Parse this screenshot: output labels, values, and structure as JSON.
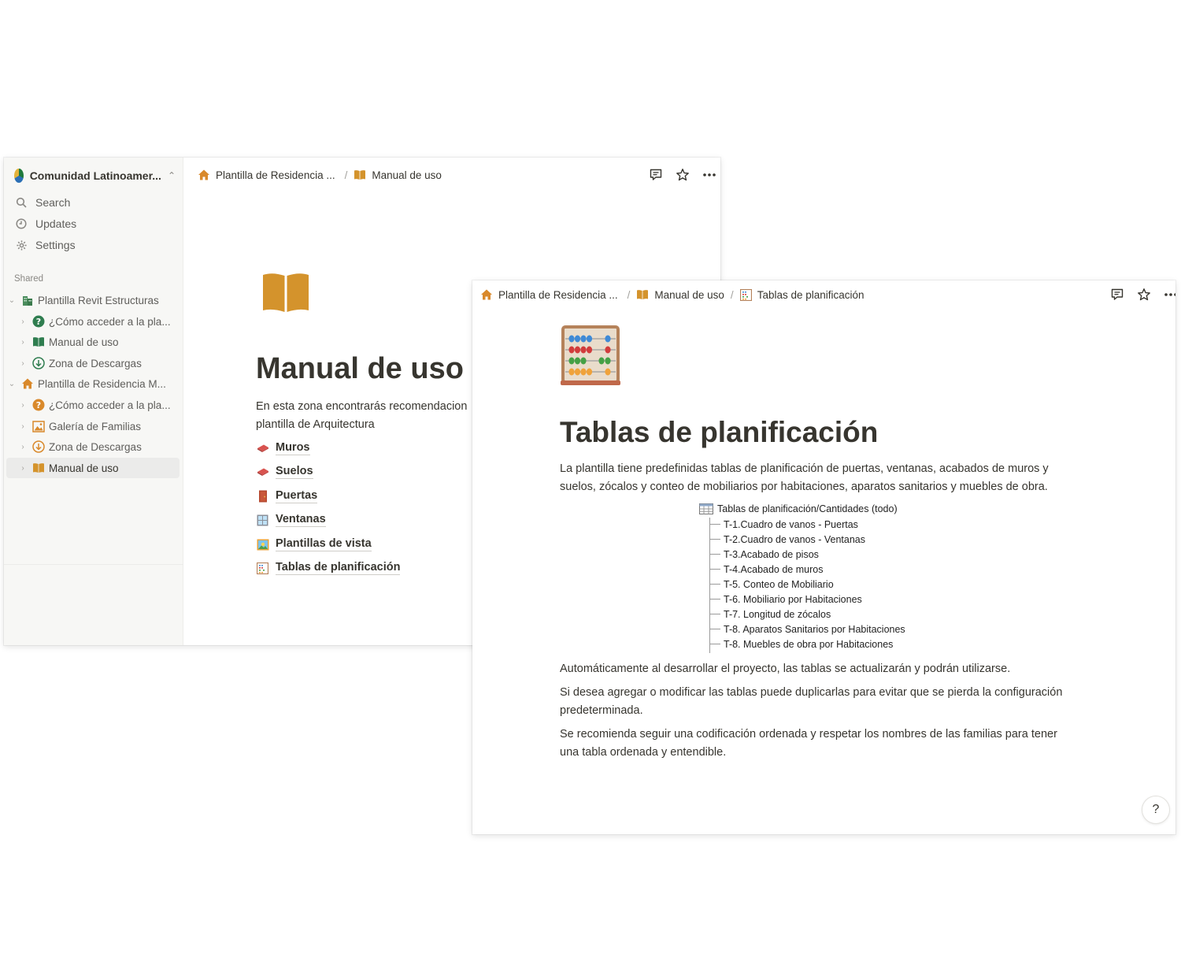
{
  "window1": {
    "sidebar": {
      "workspace_name": "Comunidad Latinoamer...",
      "nav": [
        {
          "label": "Search",
          "icon": "search-icon"
        },
        {
          "label": "Updates",
          "icon": "clock-icon"
        },
        {
          "label": "Settings",
          "icon": "gear-icon"
        }
      ],
      "shared_label": "Shared",
      "tree": [
        {
          "label": "Plantilla Revit Estructuras",
          "icon": "building-icon",
          "level": 0,
          "expanded": true
        },
        {
          "label": "¿Cómo acceder a la pla...",
          "icon": "question-icon",
          "level": 1
        },
        {
          "label": "Manual de uso",
          "icon": "book-icon",
          "level": 1
        },
        {
          "label": "Zona de Descargas",
          "icon": "download-icon",
          "level": 1
        },
        {
          "label": "Plantilla de Residencia M...",
          "icon": "house-icon",
          "level": 0,
          "expanded": true
        },
        {
          "label": "¿Cómo acceder a la pla...",
          "icon": "question-icon",
          "level": 1
        },
        {
          "label": "Galería de Familias",
          "icon": "picture-icon",
          "level": 1
        },
        {
          "label": "Zona de Descargas",
          "icon": "download-icon",
          "level": 1
        },
        {
          "label": "Manual de uso",
          "icon": "book-icon",
          "level": 1,
          "selected": true
        }
      ]
    },
    "topbar": {
      "crumb1": "Plantilla de Residencia ...",
      "crumb2": "Manual de uso"
    },
    "page": {
      "title": "Manual de uso",
      "intro_line1": "En esta zona encontrarás recomendacion",
      "intro_line2": "plantilla de Arquitectura",
      "links": [
        {
          "label": "Muros",
          "icon": "brick-icon"
        },
        {
          "label": "Suelos",
          "icon": "brick-icon"
        },
        {
          "label": "Puertas",
          "icon": "door-icon"
        },
        {
          "label": "Ventanas",
          "icon": "window-icon"
        },
        {
          "label": "Plantillas de vista",
          "icon": "landscape-icon"
        },
        {
          "label": "Tablas de planificación",
          "icon": "abacus-icon"
        }
      ]
    }
  },
  "window2": {
    "topbar": {
      "crumb1": "Plantilla de Residencia ...",
      "crumb2": "Manual de uso",
      "crumb3": "Tablas de planificación"
    },
    "page": {
      "title": "Tablas de planificación",
      "para1_line1": "La plantilla tiene predefinidas tablas de planificación de puertas, ventanas, acabados de muros y",
      "para1_line2": "suelos, zócalos y conteo de mobiliarios por habitaciones, aparatos sanitarios y muebles de obra.",
      "schedule_root": "Tablas de planificación/Cantidades (todo)",
      "schedules": [
        "T-1.Cuadro de vanos - Puertas",
        "T-2.Cuadro de vanos - Ventanas",
        "T-3.Acabado de pisos",
        "T-4.Acabado de muros",
        "T-5. Conteo de Mobiliario",
        "T-6. Mobiliario por Habitaciones",
        "T-7. Longitud de zócalos",
        "T-8. Aparatos Sanitarios por Habitaciones",
        "T-8. Muebles de obra por Habitaciones"
      ],
      "para2": "Automáticamente al desarrollar el proyecto, las tablas se actualizarán y podrán utilizarse.",
      "para3_line1": "Si desea agregar o modificar las tablas puede duplicarlas para evitar que se pierda la configuración",
      "para3_line2": "predeterminada.",
      "para4_line1": "Se recomienda seguir una codificación ordenada y respetar los nombres de las familias para tener",
      "para4_line2": "una tabla ordenada y entendible.",
      "help_label": "?"
    }
  },
  "colors": {
    "accent_orange": "#d9892b",
    "book": "#d4932c",
    "text": "#37352f",
    "sidebar_bg": "#f7f7f5",
    "selected_bg": "#ebebea"
  }
}
